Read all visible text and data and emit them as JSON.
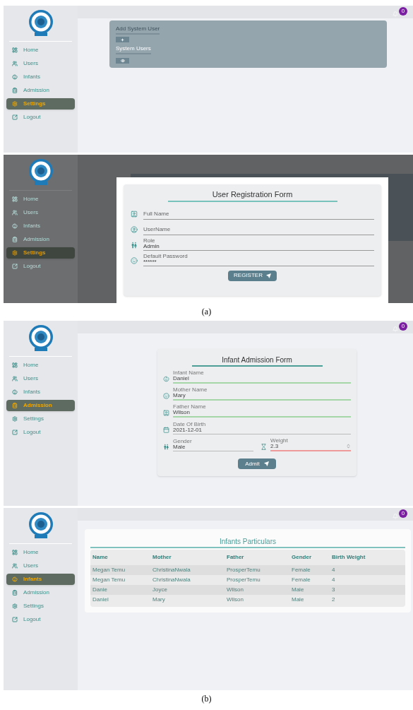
{
  "figures": [
    {
      "caption": "(a)",
      "screens": [
        {
          "kind": "settings",
          "badge": "0",
          "nav": [
            {
              "label": "Home",
              "selected": false
            },
            {
              "label": "Users",
              "selected": false
            },
            {
              "label": "Infants",
              "selected": false
            },
            {
              "label": "Admission",
              "selected": false
            },
            {
              "label": "Settings",
              "selected": true
            },
            {
              "label": "Logout",
              "selected": false
            }
          ],
          "card": {
            "add_heading": "Add System User",
            "list_heading": "System Users"
          }
        },
        {
          "kind": "registration",
          "nav": [
            {
              "label": "Home",
              "selected": false
            },
            {
              "label": "Users",
              "selected": false
            },
            {
              "label": "Infants",
              "selected": false
            },
            {
              "label": "Admission",
              "selected": false
            },
            {
              "label": "Settings",
              "selected": true
            },
            {
              "label": "Logout",
              "selected": false
            }
          ],
          "form": {
            "title": "User Registration Form",
            "fields": [
              {
                "placeholder": "Full Name"
              },
              {
                "placeholder": "UserName"
              },
              {
                "label": "Role",
                "value": "Admin"
              },
              {
                "label": "Default Password",
                "value": "******"
              }
            ],
            "button": "REGISTER"
          }
        }
      ]
    },
    {
      "caption": "(b)",
      "screens": [
        {
          "kind": "admission",
          "badge": "0",
          "nav": [
            {
              "label": "Home",
              "selected": false
            },
            {
              "label": "Users",
              "selected": false
            },
            {
              "label": "Infants",
              "selected": false
            },
            {
              "label": "Admission",
              "selected": true
            },
            {
              "label": "Settings",
              "selected": false
            },
            {
              "label": "Logout",
              "selected": false
            }
          ],
          "form": {
            "title": "Infant Admission Form",
            "rows": [
              [
                {
                  "label": "Infant Name",
                  "value": "Daniel",
                  "valid": true,
                  "invalid": false
                }
              ],
              [
                {
                  "label": "Mother Name",
                  "value": "Mary",
                  "valid": true,
                  "invalid": false
                }
              ],
              [
                {
                  "label": "Father Name",
                  "value": "Wilson",
                  "valid": true,
                  "invalid": false
                }
              ],
              [
                {
                  "label": "Date Of Birth",
                  "value": "2021-12-01",
                  "valid": false,
                  "invalid": false
                }
              ],
              [
                {
                  "label": "Gender",
                  "value": "Male",
                  "valid": false,
                  "invalid": false
                },
                {
                  "label": "Weight",
                  "value": "2.3",
                  "valid": false,
                  "invalid": true
                }
              ]
            ],
            "button": "Admit"
          }
        },
        {
          "kind": "table",
          "badge": "0",
          "nav": [
            {
              "label": "Home",
              "selected": false
            },
            {
              "label": "Users",
              "selected": false
            },
            {
              "label": "Infants",
              "selected": true
            },
            {
              "label": "Admission",
              "selected": false
            },
            {
              "label": "Settings",
              "selected": false
            },
            {
              "label": "Logout",
              "selected": false
            }
          ],
          "table": {
            "title": "Infants Particulars",
            "columns": [
              "Name",
              "Mother",
              "Father",
              "Gender",
              "Birth Weight"
            ],
            "rows": [
              [
                "Megan Temu",
                "ChristinaNwala",
                "ProsperTemu",
                "Female",
                "4"
              ],
              [
                "Megan Temu",
                "ChristinaNwala",
                "ProsperTemu",
                "Female",
                "4"
              ],
              [
                "Danie",
                "Joyce",
                "Wilson",
                "Male",
                "3"
              ],
              [
                "Daniel",
                "Mary",
                "Wilson",
                "Male",
                "2"
              ]
            ]
          }
        }
      ]
    }
  ]
}
